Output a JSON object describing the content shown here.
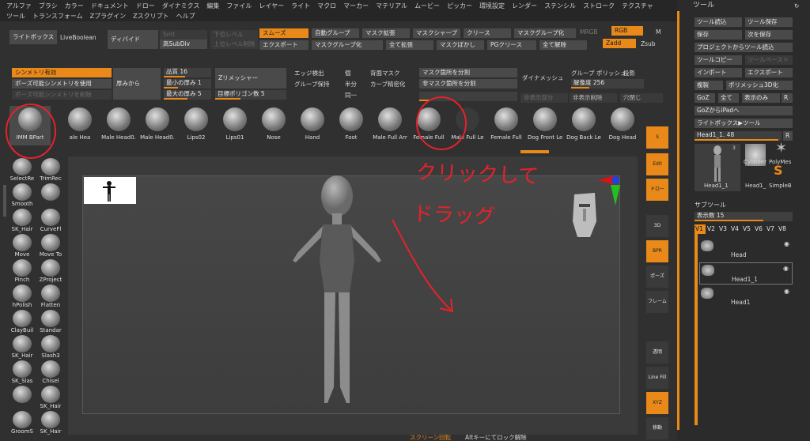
{
  "menu": [
    "アルファ",
    "ブラシ",
    "カラー",
    "ドキュメント",
    "ドロー",
    "ダイナミクス",
    "編集",
    "ファイル",
    "レイヤー",
    "ライト",
    "マクロ",
    "マーカー",
    "マテリアル",
    "ムービー",
    "ピッカー",
    "環境設定",
    "レンダー",
    "ステンシル",
    "ストローク",
    "テクスチャ",
    "ツール",
    "トランスフォーム",
    "Zプラグイン",
    "Zスクリプト",
    "ヘルプ"
  ],
  "toolbar1": {
    "lightbox": "ライトボックス",
    "liveboolean": "LiveBoolean",
    "divide": "ディバイド",
    "smt": "Smt",
    "subdiv": "高SubDiv",
    "lower_level": "下位レベル",
    "upper_level": "上位レベル削除",
    "smooth": "スムーズ",
    "auto_group": "自動グループ",
    "mask_expand": "マスク拡張",
    "mask_sharp": "マスクシャープ",
    "crease": "クリース",
    "mask_group": "マスクグループ化",
    "mrgb": "MRGB",
    "rgb": "RGB",
    "m": "M",
    "export": "エクスポート",
    "mask_grouping": "マスクグループ化",
    "all_expand": "全て拡張",
    "mask_blur": "マスクぼかし",
    "pg_crease": "PGクリース",
    "all_release": "全て解除",
    "zadd": "Zadd",
    "zsub": "Zsub"
  },
  "toolbar2": {
    "symmetry_on": "シンメトリ有効",
    "pose_symmetry": "ポーズ可能シンメトリを使用",
    "pose_symmetry_del": "ポーズ可能シンメトリを削除",
    "thickness_from": "厚みから",
    "quality": "品質 16",
    "min_thickness": "最小の厚み 1",
    "max_thickness": "最大の厚み 5",
    "zremesher": "Zリメッシャー",
    "target_polygons": "目標ポリゴン数 5",
    "edge_detect": "エッジ検出",
    "group_keep": "グループ保持",
    "ko": "個",
    "half": "半分",
    "same": "同一",
    "back_mask": "背面マスク",
    "curve_refine": "カーブ精密化",
    "split_mask": "マスク箇所を分割",
    "split_unmask": "非マスク箇所を分割",
    "dynamesh": "ダイナメッシュ",
    "group": "グループ",
    "polish": "ポリッシュ",
    "project": "投影",
    "resolution": "解像度 256",
    "split_hidden": "非表示部分",
    "hidden_delete": "非表示削除",
    "close_holes": "穴閉じ"
  },
  "brushes_top": [
    "IMM BPart",
    "ale Hea",
    "Male Head0.",
    "Male Head0.",
    "Lips02",
    "Lips01",
    "Nose",
    "Hand",
    "Foot",
    "Male Full Arr",
    "Female Full",
    "Male Full Le",
    "Female Full",
    "Dog Front Le",
    "Dog Back Le",
    "Dog Head"
  ],
  "brushes_left": [
    [
      "SelectRe",
      "TrimRec"
    ],
    [
      "Smooth",
      ""
    ],
    [
      "SK_Hair",
      "CurveFl"
    ],
    [
      "Move",
      "Move To"
    ],
    [
      "Pinch",
      "ZProject"
    ],
    [
      "hPolish",
      "Flatten"
    ],
    [
      "ClayBuil",
      "Standar"
    ],
    [
      "SK_Hair",
      "Slash3"
    ],
    [
      "SK_Slas",
      "Chisel"
    ],
    [
      "",
      "SK_Hair"
    ],
    [
      "GroomS",
      "SK_Hair"
    ]
  ],
  "right_icons": {
    "sdiv": "S",
    "edit": "Edit",
    "draw": "ドロー",
    "zoom": "3D",
    "bpr": "BPR",
    "pose": "ポーズ",
    "frame": "フレーム",
    "solo": "ソロ",
    "transp": "透明",
    "linefill": "Line Fill",
    "move": "移動",
    "xyz": "XYZ"
  },
  "canvas_note": "クリックして\nドラッグ",
  "status": {
    "rotate": "スクリーン回転",
    "lock": "Altキーにてロック解除"
  },
  "tool_panel": {
    "title": "ツール",
    "load": "ツール読込",
    "save_as": "ツール保存",
    "save": "保存",
    "save_next": "次を保存",
    "load_proj": "プロジェクトからツール読込",
    "copy": "ツールコピー",
    "paste": "ツールペースト",
    "import": "インポート",
    "export": "エクスポート",
    "clone": "複製",
    "polymesh": "ポリメッシュ3D化",
    "goz": "GoZ",
    "all": "全て",
    "visible": "表示のみ",
    "r": "R",
    "goz_ipad": "GoZからiPadへ",
    "lightbox_tool": "ライトボックス▶ツール",
    "current": "Head1_1. 48",
    "thumb_count": "3",
    "thumb1": "Head1_1",
    "thumb2": "Cylinder",
    "thumb3": "PolyMes",
    "thumb4": "Head1_",
    "thumb5": "SimpleB",
    "subtool_title": "サブツール",
    "display_count": "表示数 15",
    "versions": [
      "V1",
      "V2",
      "V3",
      "V4",
      "V5",
      "V6",
      "V7",
      "V8"
    ],
    "subtools": [
      "Head",
      "Head1_1",
      "Head1"
    ]
  }
}
